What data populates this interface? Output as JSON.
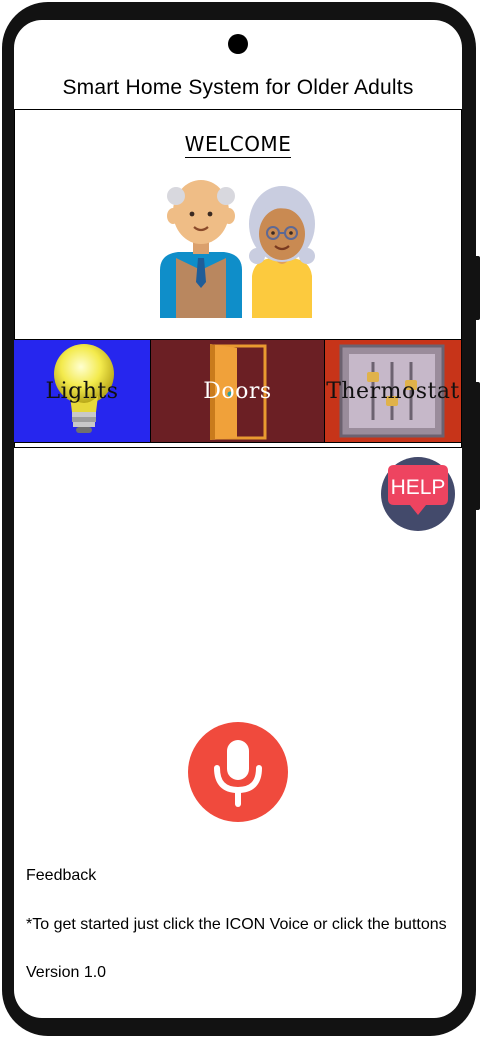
{
  "app": {
    "title": "Smart Home System for Older Adults"
  },
  "welcome": {
    "heading": "WELCOME",
    "illustration_icon": "older-couple-illustration"
  },
  "tiles": [
    {
      "label": "Lights",
      "icon": "lightbulb-icon",
      "color": "#2626ee"
    },
    {
      "label": "Doors",
      "icon": "door-icon",
      "color": "#6b1f24"
    },
    {
      "label": "Thermostat",
      "icon": "thermostat-icon",
      "color": "#c73419"
    }
  ],
  "help": {
    "label": "HELP",
    "color": "#ee4460",
    "ring_color": "#434a6b"
  },
  "voice": {
    "icon": "microphone-icon",
    "color": "#f04a3d"
  },
  "footer": {
    "feedback": "Feedback",
    "instructions": "*To get started just click the ICON Voice or click the buttons",
    "version": "Version 1.0"
  }
}
